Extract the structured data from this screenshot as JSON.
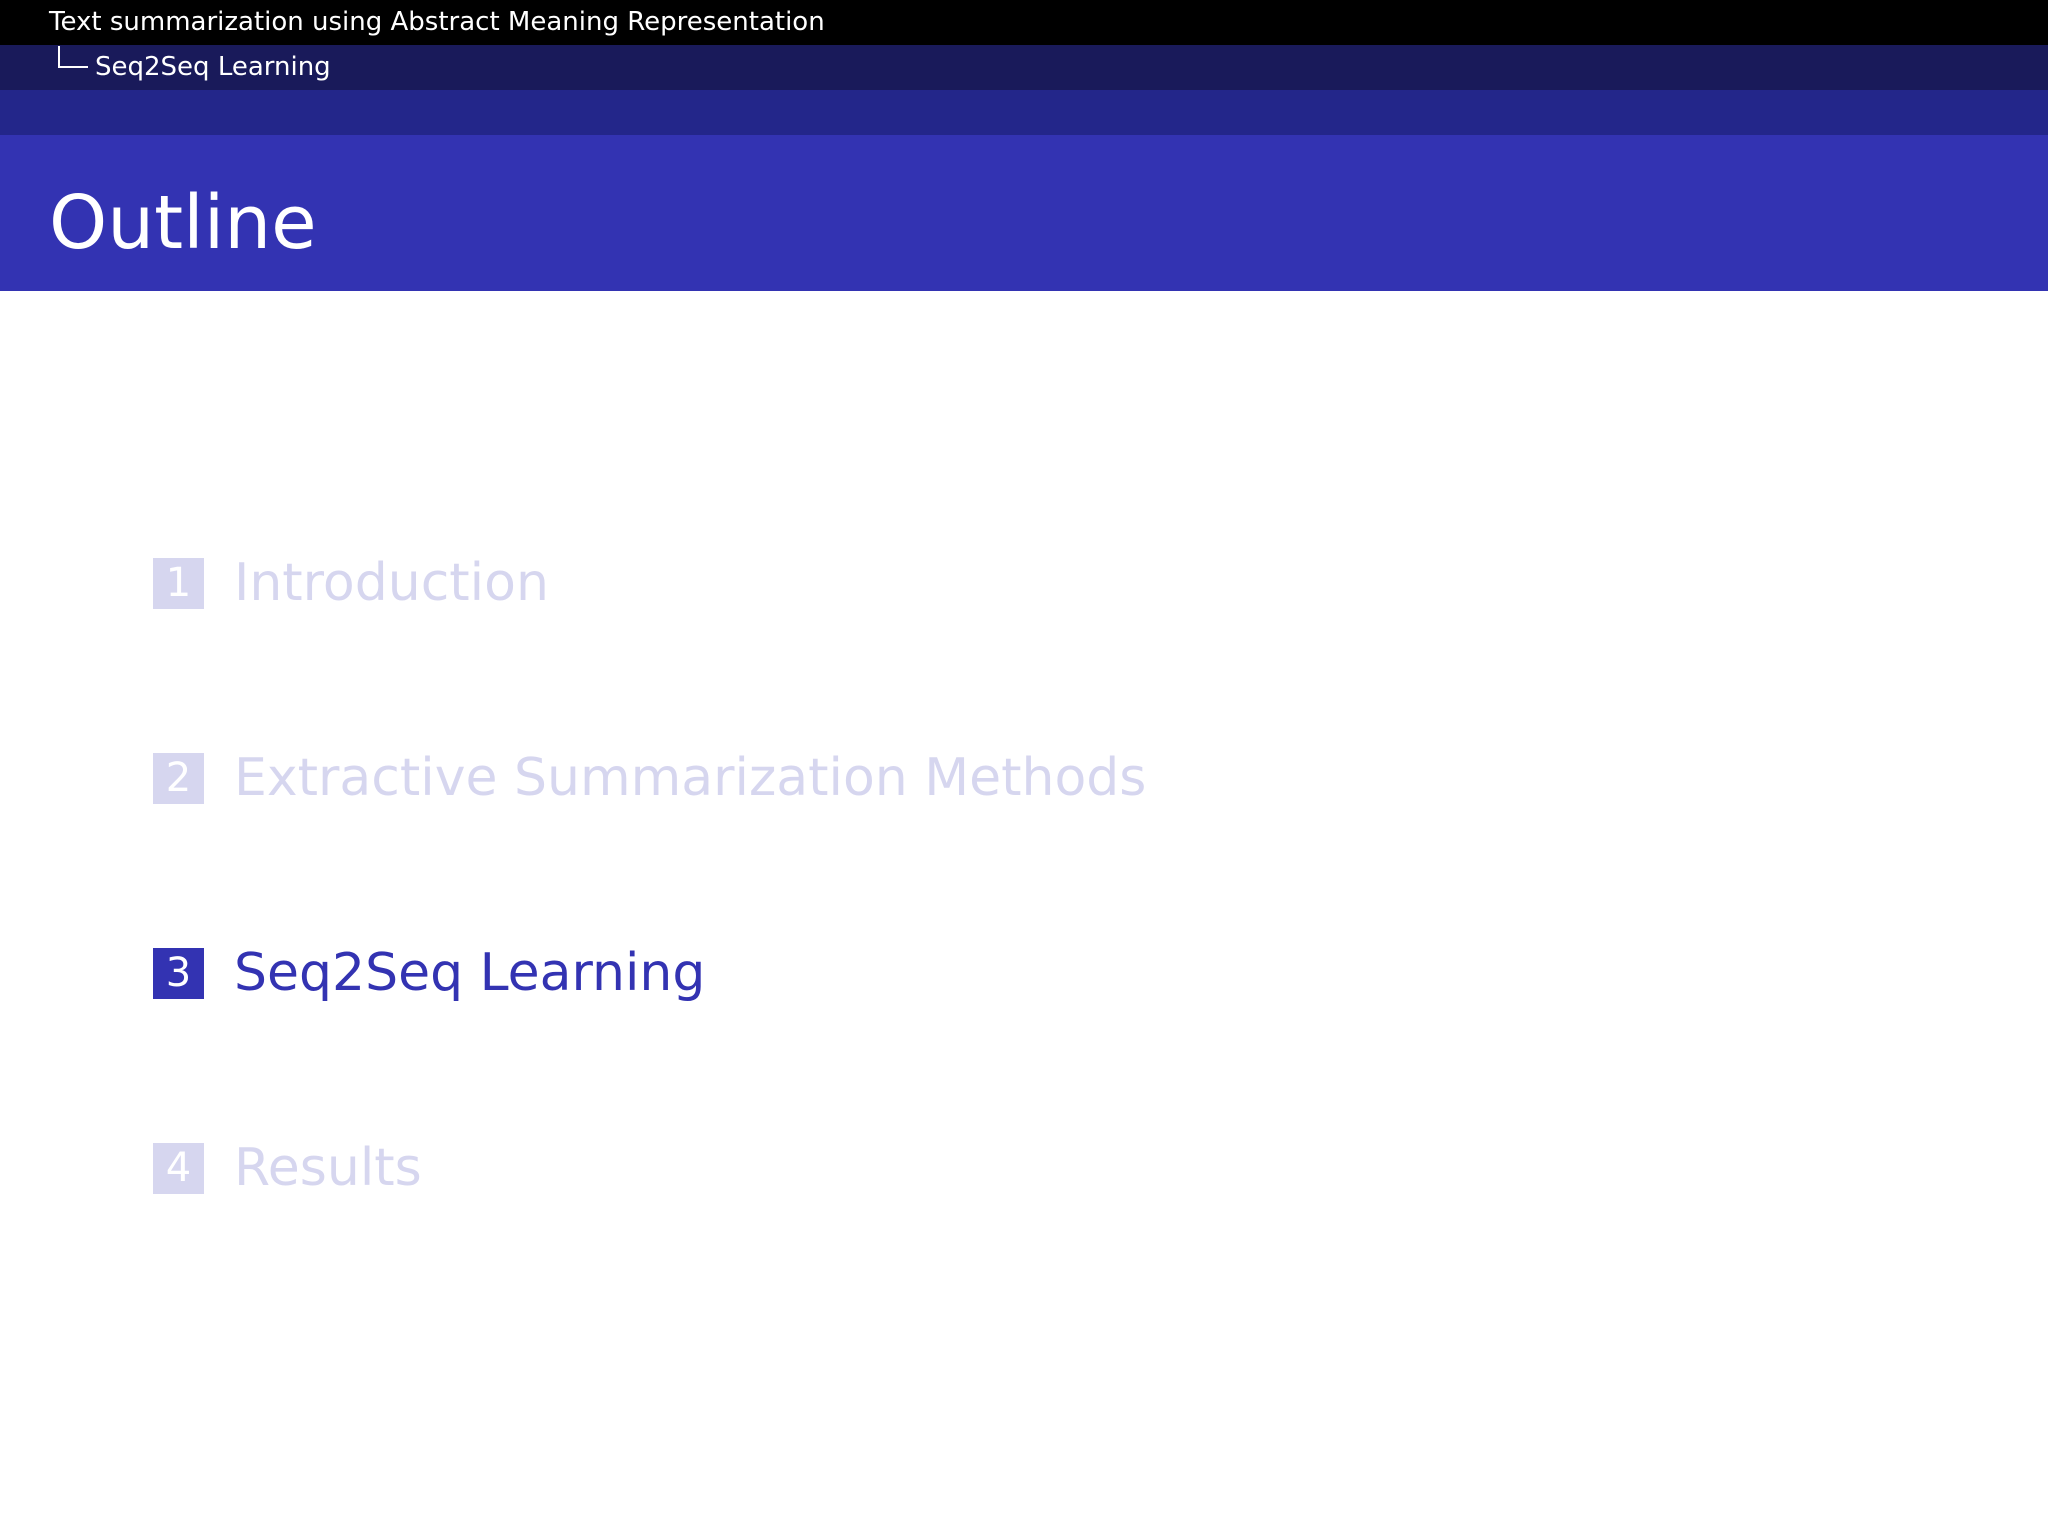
{
  "header": {
    "presentation_title": "Text summarization using Abstract Meaning Representation",
    "section_title": "Seq2Seq Learning"
  },
  "frame": {
    "title": "Outline"
  },
  "toc": {
    "items": [
      {
        "number": "1",
        "label": "Introduction",
        "active": false
      },
      {
        "number": "2",
        "label": "Extractive Summarization Methods",
        "active": false
      },
      {
        "number": "3",
        "label": "Seq2Seq Learning",
        "active": true
      },
      {
        "number": "4",
        "label": "Results",
        "active": false
      }
    ]
  },
  "colors": {
    "header_black": "#000000",
    "header_dark_navy": "#191a5a",
    "header_navy": "#23268a",
    "frametitle_blue": "#3333b2",
    "inactive_faded": "#d6d6ef",
    "text_white": "#ffffff"
  }
}
